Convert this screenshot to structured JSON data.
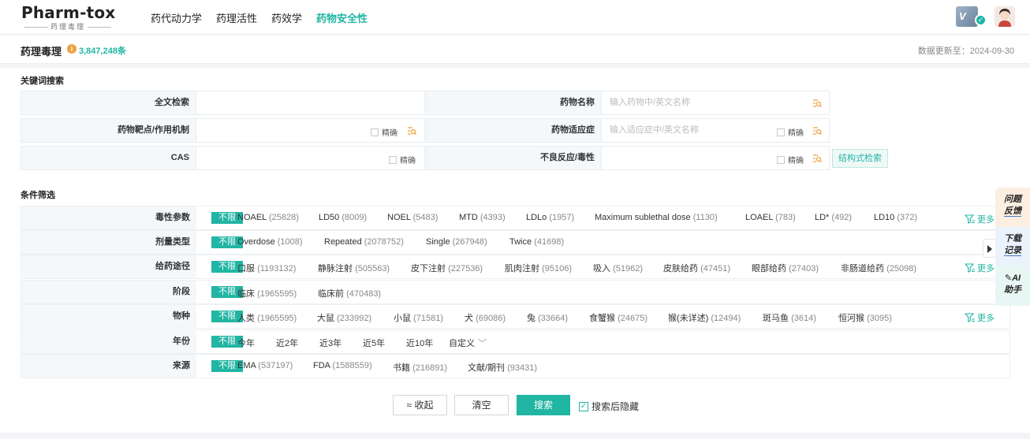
{
  "brand": {
    "name": "Pharm-tox",
    "sub": "药理毒理"
  },
  "nav": [
    "药代动力学",
    "药理活性",
    "药效学",
    "药物安全性"
  ],
  "header": {
    "title": "药理毒理",
    "count": "3,847,248条",
    "update": "数据更新至：2024-09-30"
  },
  "vip_label": "V",
  "keyword": {
    "title": "关键词搜索",
    "fulltext_label": "全文检索",
    "drug_name_label": "药物名称",
    "drug_name_placeholder": "输入药物中/英文名称",
    "target_label": "药物靶点/作用机制",
    "indication_label": "药物适应症",
    "indication_placeholder": "输入适应症中/英文名称",
    "cas_label": "CAS",
    "adverse_label": "不良反应/毒性",
    "precise": "精确",
    "structure_btn": "结构式检索"
  },
  "filters": {
    "title": "条件筛选",
    "unlimited": "不限",
    "more": "更多",
    "rows": [
      {
        "label": "毒性参数",
        "more": true,
        "opts": [
          {
            "t": "NOAEL",
            "n": "(25828)"
          },
          {
            "t": "LD50",
            "n": "(8009)"
          },
          {
            "t": "NOEL",
            "n": "(5483)"
          },
          {
            "t": "MTD",
            "n": "(4393)"
          },
          {
            "t": "LDLo",
            "n": "(1957)"
          },
          {
            "t": "Maximum sublethal dose",
            "n": "(1130)"
          },
          {
            "t": "LOAEL",
            "n": "(783)"
          },
          {
            "t": "LD*",
            "n": "(492)"
          },
          {
            "t": "LD10",
            "n": "(372)"
          }
        ]
      },
      {
        "label": "剂量类型",
        "more": false,
        "opts": [
          {
            "t": "Overdose",
            "n": "(1008)"
          },
          {
            "t": "Repeated",
            "n": "(2078752)"
          },
          {
            "t": "Single",
            "n": "(267948)"
          },
          {
            "t": "Twice",
            "n": "(41698)"
          }
        ]
      },
      {
        "label": "给药途径",
        "more": true,
        "opts": [
          {
            "t": "口服",
            "n": "(1193132)"
          },
          {
            "t": "静脉注射",
            "n": "(505563)"
          },
          {
            "t": "皮下注射",
            "n": "(227536)"
          },
          {
            "t": "肌肉注射",
            "n": "(95106)"
          },
          {
            "t": "吸入",
            "n": "(51962)"
          },
          {
            "t": "皮肤给药",
            "n": "(47451)"
          },
          {
            "t": "眼部给药",
            "n": "(27403)"
          },
          {
            "t": "非肠道给药",
            "n": "(25098)"
          }
        ]
      },
      {
        "label": "阶段",
        "more": false,
        "opts": [
          {
            "t": "临床",
            "n": "(1965595)"
          },
          {
            "t": "临床前",
            "n": "(470483)"
          }
        ]
      },
      {
        "label": "物种",
        "more": true,
        "opts": [
          {
            "t": "人类",
            "n": "(1965595)"
          },
          {
            "t": "大鼠",
            "n": "(233992)"
          },
          {
            "t": "小鼠",
            "n": "(71581)"
          },
          {
            "t": "犬",
            "n": "(69086)"
          },
          {
            "t": "兔",
            "n": "(33664)"
          },
          {
            "t": "食蟹猴",
            "n": "(24675)"
          },
          {
            "t": "猴(未详述)",
            "n": "(12494)"
          },
          {
            "t": "斑马鱼",
            "n": "(3614)"
          },
          {
            "t": "恒河猴",
            "n": "(3095)"
          }
        ]
      },
      {
        "label": "年份",
        "more": false,
        "opts": [
          {
            "t": "今年",
            "n": ""
          },
          {
            "t": "近2年",
            "n": ""
          },
          {
            "t": "近3年",
            "n": ""
          },
          {
            "t": "近5年",
            "n": ""
          },
          {
            "t": "近10年",
            "n": ""
          },
          {
            "t": "自定义",
            "n": ""
          }
        ]
      },
      {
        "label": "来源",
        "more": false,
        "opts": [
          {
            "t": "EMA",
            "n": "(537197)"
          },
          {
            "t": "FDA",
            "n": "(1588559)"
          },
          {
            "t": "书籍",
            "n": "(216891)"
          },
          {
            "t": "文献/期刊",
            "n": "(93431)"
          }
        ]
      }
    ]
  },
  "actions": {
    "collapse": "收起",
    "clear": "清空",
    "search": "搜索",
    "hide_after": "搜索后隐藏"
  },
  "float": {
    "feedback": [
      "问题",
      "反馈"
    ],
    "download": [
      "下载",
      "记录"
    ],
    "ai": [
      "AI",
      "助手"
    ]
  },
  "colors": {
    "accent": "#21b5a3"
  }
}
